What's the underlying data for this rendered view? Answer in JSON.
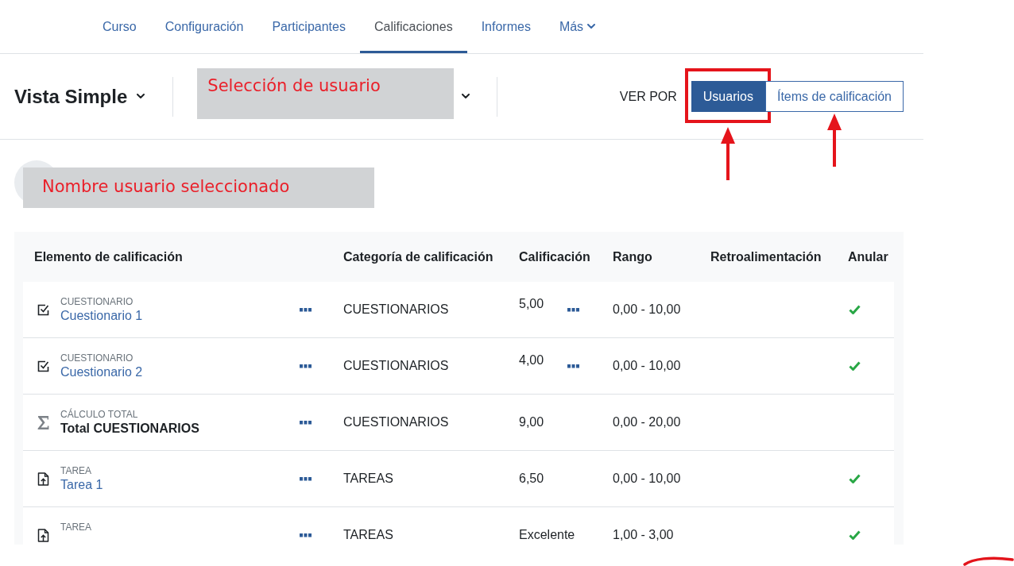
{
  "nav": {
    "tabs": [
      {
        "label": "Curso",
        "selected": false,
        "kind": "link"
      },
      {
        "label": "Configuración",
        "selected": false,
        "kind": "link"
      },
      {
        "label": "Participantes",
        "selected": false,
        "kind": "link"
      },
      {
        "label": "Calificaciones",
        "selected": true,
        "kind": "link"
      },
      {
        "label": "Informes",
        "selected": false,
        "kind": "link"
      },
      {
        "label": "Más",
        "selected": false,
        "kind": "menu"
      }
    ]
  },
  "header": {
    "view_selector": {
      "label": "Vista Simple"
    },
    "user_selector": {
      "annotation": "Selección de usuario"
    },
    "view_by": {
      "label": "VER POR",
      "options": [
        {
          "label": "Usuarios",
          "selected": true,
          "highlighted": true,
          "arrow": true
        },
        {
          "label": "Ítems de calificación",
          "selected": false,
          "highlighted": false,
          "arrow": true
        }
      ]
    }
  },
  "user": {
    "annotation": "Nombre usuario seleccionado"
  },
  "table": {
    "columns": [
      "Elemento de calificación",
      "Categoría de calificación",
      "Calificación",
      "Rango",
      "Retroalimentación",
      "Anular"
    ],
    "rows": [
      {
        "kind": "quiz",
        "type": "CUESTIONARIO",
        "name": "Cuestionario 1",
        "category": "CUESTIONARIOS",
        "grade": "5,00",
        "grade_menu": true,
        "range": "0,00 - 10,00",
        "overridden": true
      },
      {
        "kind": "quiz",
        "type": "CUESTIONARIO",
        "name": "Cuestionario 2",
        "category": "CUESTIONARIOS",
        "grade": "4,00",
        "grade_menu": true,
        "range": "0,00 - 10,00",
        "overridden": true
      },
      {
        "kind": "total",
        "type": "CÁLCULO TOTAL",
        "name": "Total CUESTIONARIOS",
        "category": "CUESTIONARIOS",
        "grade": "9,00",
        "grade_menu": false,
        "range": "0,00 - 20,00",
        "overridden": false
      },
      {
        "kind": "assignment",
        "type": "TAREA",
        "name": "Tarea 1",
        "category": "TAREAS",
        "grade": "6,50",
        "grade_menu": false,
        "range": "0,00 - 10,00",
        "overridden": true
      },
      {
        "kind": "assignment",
        "type": "TAREA",
        "category": "TAREAS",
        "grade": "Excelente",
        "grade_menu": false,
        "range": "1,00 - 3,00",
        "overridden": true
      }
    ]
  },
  "scribble": true
}
